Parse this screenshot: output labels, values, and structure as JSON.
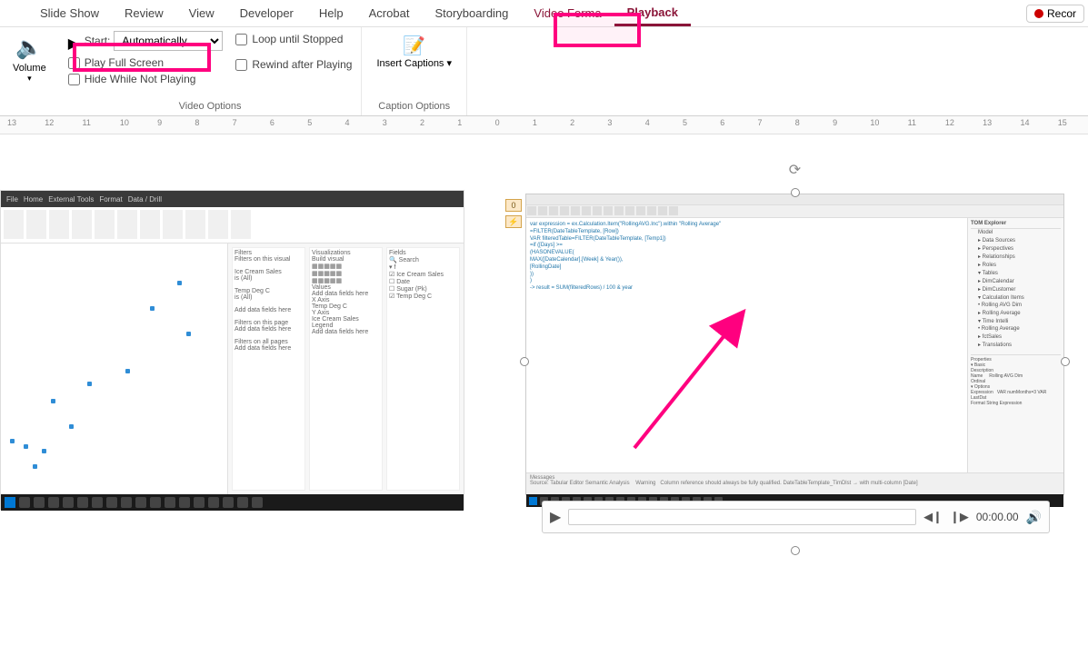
{
  "tabs": {
    "slideShow": "Slide Show",
    "review": "Review",
    "view": "View",
    "developer": "Developer",
    "help": "Help",
    "acrobat": "Acrobat",
    "storyboarding": "Storyboarding",
    "videoFormat": "Video Forma",
    "playback": "Playback",
    "record": "Recor"
  },
  "ribbon": {
    "volume": "Volume",
    "startLabel": "Start:",
    "startValue": "Automatically",
    "playFullScreen": "Play Full Screen",
    "hideWhileNotPlaying": "Hide While Not Playing",
    "loopUntilStopped": "Loop until Stopped",
    "rewindAfterPlaying": "Rewind after Playing",
    "videoOptions": "Video Options",
    "insertCaptions": "Insert\nCaptions",
    "captionOptions": "Caption Options"
  },
  "ruler": {
    "ticks": [
      "13",
      "12",
      "11",
      "10",
      "9",
      "8",
      "7",
      "6",
      "5",
      "4",
      "3",
      "2",
      "1",
      "0",
      "1",
      "2",
      "3",
      "4",
      "5",
      "6",
      "7",
      "8",
      "9",
      "10",
      "11",
      "12",
      "13",
      "14",
      "15"
    ]
  },
  "vid2": {
    "badge1": "0",
    "badge2": "⚡",
    "explorerTitle": "TOM Explorer",
    "codeLines": [
      "var expression = ex.Calculation.Item(\"RollingAVG.Inc\").within \"Rolling Average\"",
      "  =FILTER(DateTableTemplate, [Row])",
      "  VAR filteredTable=FILTER(DateTableTemplate, [Temp1])",
      "  =if ([Days] >= ",
      "      (HASONEVALUE(",
      "        MAX([DateCalendar].[Week] & Year()),",
      "        [RollingDate]",
      "      ))",
      "  )",
      "  -> result = SUM(filteredRows) / 100 & year"
    ],
    "treeItems": [
      "Model",
      "▸ Data Sources",
      "▸ Perspectives",
      "▸ Relationships",
      "▸ Roles",
      "▾ Tables",
      "  ▸ DimCalendar",
      "  ▸ DimCustomer",
      "  ▾ Calculation Items",
      "    • Rolling AVG Dim",
      "    ▸ Rolling Average",
      "    ▾ Time Intelli",
      "      • Rolling Average",
      "  ▸ fctSales",
      "▸ Translations"
    ]
  },
  "player": {
    "time": "00:00.00"
  }
}
